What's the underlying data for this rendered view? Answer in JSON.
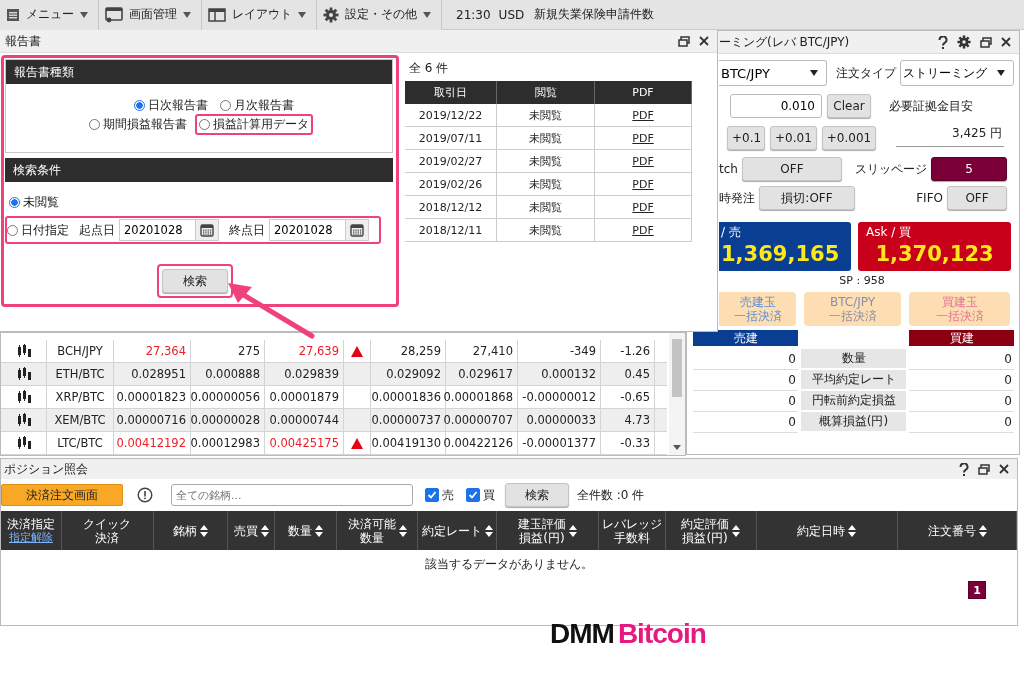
{
  "toolbar": {
    "items": [
      {
        "label": "メニュー"
      },
      {
        "label": "画面管理"
      },
      {
        "label": "レイアウト"
      },
      {
        "label": "設定・その他"
      }
    ],
    "time": "21:30",
    "currency": "USD",
    "event": "新規失業保険申請件数"
  },
  "report_window": {
    "title": "報告書",
    "highlighted": true,
    "type_section": {
      "heading": "報告書種類",
      "options": [
        {
          "label": "日次報告書",
          "selected": true,
          "highlighted": false
        },
        {
          "label": "月次報告書",
          "selected": false,
          "highlighted": false
        },
        {
          "label": "期間損益報告書",
          "selected": false,
          "highlighted": false
        },
        {
          "label": "損益計算用データ",
          "selected": false,
          "highlighted": true
        }
      ]
    },
    "search_section": {
      "heading": "検索条件",
      "unread": {
        "label": "未閲覧",
        "selected": true
      },
      "by_date": {
        "label": "日付指定",
        "selected": false
      },
      "date_row_highlighted": true,
      "start_label": "起点日",
      "start_date": "20201028",
      "end_label": "終点日",
      "end_date": "20201028",
      "button": "検索",
      "button_highlighted": true
    },
    "count": "全 6 件",
    "table": {
      "columns": [
        "取引日",
        "閲覧",
        "PDF"
      ],
      "rows": [
        {
          "date": "2019/12/22",
          "status": "未閲覧",
          "link": "PDF"
        },
        {
          "date": "2019/07/11",
          "status": "未閲覧",
          "link": "PDF"
        },
        {
          "date": "2019/02/27",
          "status": "未閲覧",
          "link": "PDF"
        },
        {
          "date": "2019/02/26",
          "status": "未閲覧",
          "link": "PDF"
        },
        {
          "date": "2018/12/12",
          "status": "未閲覧",
          "link": "PDF"
        },
        {
          "date": "2018/12/11",
          "status": "未閲覧",
          "link": "PDF"
        }
      ]
    }
  },
  "rates": {
    "rows": [
      {
        "pair": "BCH/JPY",
        "bid": "27,364",
        "spread": "275",
        "ask": "27,639",
        "rising": true,
        "high": "28,259",
        "low": "27,410",
        "change": "-349",
        "percent": "-1.26"
      },
      {
        "pair": "ETH/BTC",
        "bid": "0.028951",
        "spread": "0.000888",
        "ask": "0.029839",
        "rising": false,
        "high": "0.029092",
        "low": "0.029617",
        "change": "0.000132",
        "percent": "0.45"
      },
      {
        "pair": "XRP/BTC",
        "bid": "0.00001823",
        "spread": "0.00000056",
        "ask": "0.00001879",
        "rising": false,
        "high": "0.00001836",
        "low": "0.00001868",
        "change": "-0.00000012",
        "percent": "-0.65"
      },
      {
        "pair": "XEM/BTC",
        "bid": "0.00000716",
        "spread": "0.00000028",
        "ask": "0.00000744",
        "rising": false,
        "high": "0.00000737",
        "low": "0.00000707",
        "change": "0.00000033",
        "percent": "4.73"
      },
      {
        "pair": "LTC/BTC",
        "bid": "0.00412192",
        "spread": "0.00012983",
        "ask": "0.00425175",
        "rising": true,
        "high": "0.00419130",
        "low": "0.00422126",
        "change": "-0.00001377",
        "percent": "-0.33"
      }
    ]
  },
  "streaming": {
    "title": "ーミング(レバ BTC/JPY)",
    "pair": "BTC/JPY",
    "order_type_label": "注文タイプ",
    "order_type": "ストリーミング",
    "amount": "0.010",
    "clear": "Clear",
    "margin_label": "必要証拠金目安",
    "increments": [
      "+0.1",
      "+0.01",
      "+0.001"
    ],
    "margin": "3,425 円",
    "settings": [
      {
        "label": "tch",
        "value": "OFF",
        "kind": "plain"
      },
      {
        "label": "スリッページ",
        "value": "5",
        "kind": "accent"
      },
      {
        "label": "時発注",
        "value": "損切:OFF",
        "kind": "plain"
      },
      {
        "label": "FIFO",
        "value": "OFF",
        "kind": "plain"
      }
    ],
    "bid": {
      "label": "/ 売",
      "price": "1,369,165"
    },
    "ask": {
      "label": "Ask / 買",
      "price": "1,370,123"
    },
    "spread": "SP : 958",
    "bulk": [
      {
        "title": "売建玉",
        "sub": "一括決済",
        "kind": "sell",
        "disabled": true
      },
      {
        "title": "BTC/JPY",
        "sub": "一括決済",
        "kind": "both",
        "disabled": true
      },
      {
        "title": "買建玉",
        "sub": "一括決済",
        "kind": "buy",
        "disabled": true
      }
    ],
    "summary": {
      "sell_heading": "売建",
      "buy_heading": "買建",
      "rows": [
        {
          "label": "数量",
          "sell": "0",
          "buy": "0"
        },
        {
          "label": "平均約定レート",
          "sell": "0",
          "buy": "0"
        },
        {
          "label": "円転前約定損益",
          "sell": "0",
          "buy": "0"
        },
        {
          "label": "概算損益(円)",
          "sell": "0",
          "buy": "0"
        }
      ]
    }
  },
  "positions": {
    "title": "ポジション照会",
    "order_button": "決済注文画面",
    "search_placeholder": "全ての銘柄...",
    "filters": [
      {
        "label": "売",
        "checked": true
      },
      {
        "label": "買",
        "checked": true
      }
    ],
    "search_button": "検索",
    "total": "全件数 :0 件",
    "columns": [
      {
        "lines": [
          "決済指定"
        ],
        "link": "指定解除",
        "sortable": false
      },
      {
        "lines": [
          "クイック",
          "決済"
        ],
        "sortable": false
      },
      {
        "lines": [
          "銘柄"
        ],
        "sortable": true
      },
      {
        "lines": [
          "売買"
        ],
        "sortable": true
      },
      {
        "lines": [
          "数量"
        ],
        "sortable": true
      },
      {
        "lines": [
          "決済可能",
          "数量"
        ],
        "sortable": true
      },
      {
        "lines": [
          "約定レート"
        ],
        "sortable": true
      },
      {
        "lines": [
          "建玉評価",
          "損益(円)"
        ],
        "sortable": true
      },
      {
        "lines": [
          "レバレッジ",
          "手数料"
        ],
        "sortable": false
      },
      {
        "lines": [
          "約定評価",
          "損益(円)"
        ],
        "sortable": true
      },
      {
        "lines": [
          "約定日時"
        ],
        "sortable": true
      },
      {
        "lines": [
          "注文番号"
        ],
        "sortable": true
      }
    ],
    "empty_message": "該当するデータがありません。",
    "pages": [
      {
        "label": "1",
        "selected": true
      }
    ]
  },
  "logo": {
    "part_a": "DMM",
    "part_b": "Bitcoin"
  }
}
